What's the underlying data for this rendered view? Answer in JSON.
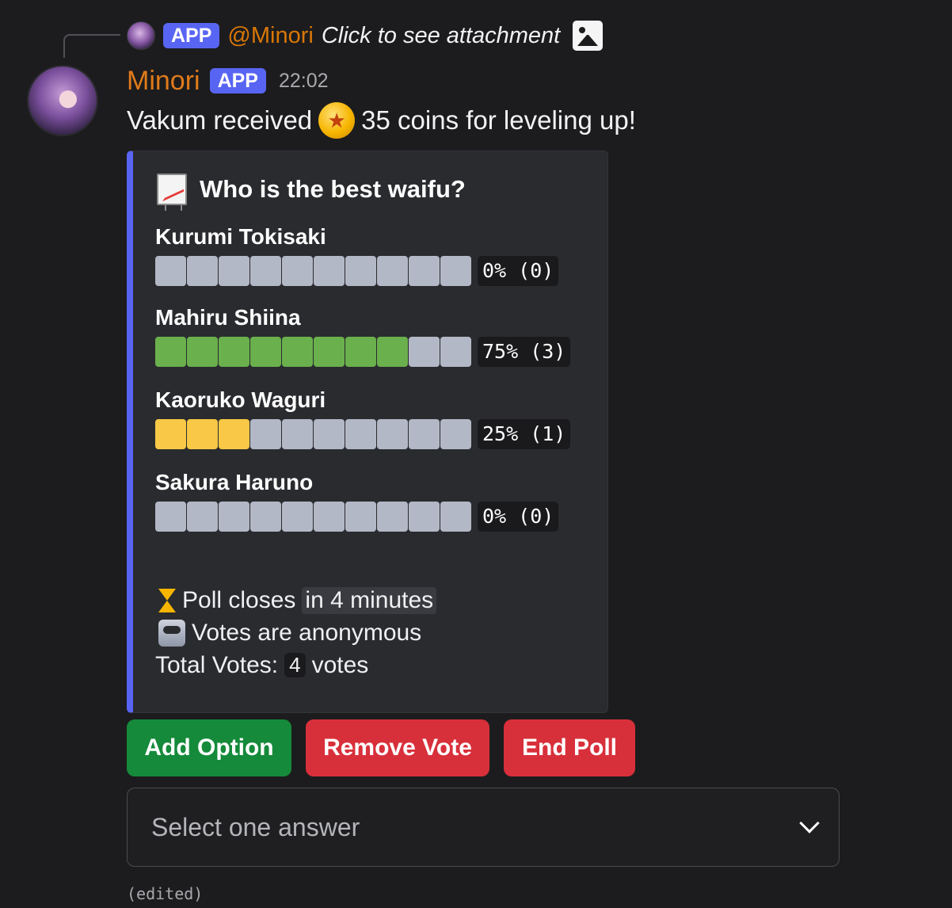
{
  "reply": {
    "app_tag": "APP",
    "mention": "@Minori",
    "text": "Click to see attachment",
    "icon": "image-icon"
  },
  "author": {
    "name": "Minori",
    "app_tag": "APP",
    "timestamp": "22:02"
  },
  "message": {
    "text_before": "Vakum received",
    "coin_icon": "star-coin-icon",
    "text_after": "35 coins for leveling up!"
  },
  "poll": {
    "accent_color": "#5865f2",
    "title_icon": "chart-icon",
    "title": "Who is the best waifu?",
    "segments_per_bar": 10,
    "options": [
      {
        "label": "Kurumi Tokisaki",
        "percent": 0,
        "votes": 0,
        "result_text": "0% (0)",
        "color": "#b3b8c6"
      },
      {
        "label": "Mahiru Shiina",
        "percent": 75,
        "votes": 3,
        "result_text": "75% (3)",
        "color": "#6ab04c"
      },
      {
        "label": "Kaoruko Waguri",
        "percent": 25,
        "votes": 1,
        "result_text": "25% (1)",
        "color": "#f8c846"
      },
      {
        "label": "Sakura Haruno",
        "percent": 0,
        "votes": 0,
        "result_text": "0% (0)",
        "color": "#b3b8c6"
      }
    ],
    "closes_icon": "hourglass-icon",
    "closes_label": "Poll closes",
    "closes_value": "in 4 minutes",
    "anonymous_icon": "ballot-box-icon",
    "anonymous_text": "Votes are anonymous",
    "total_label": "Total Votes:",
    "total_value": "4",
    "total_unit": "votes"
  },
  "buttons": {
    "add_option": "Add Option",
    "remove_vote": "Remove Vote",
    "end_poll": "End Poll"
  },
  "select": {
    "placeholder": "Select one answer"
  },
  "edited_label": "(edited)"
}
